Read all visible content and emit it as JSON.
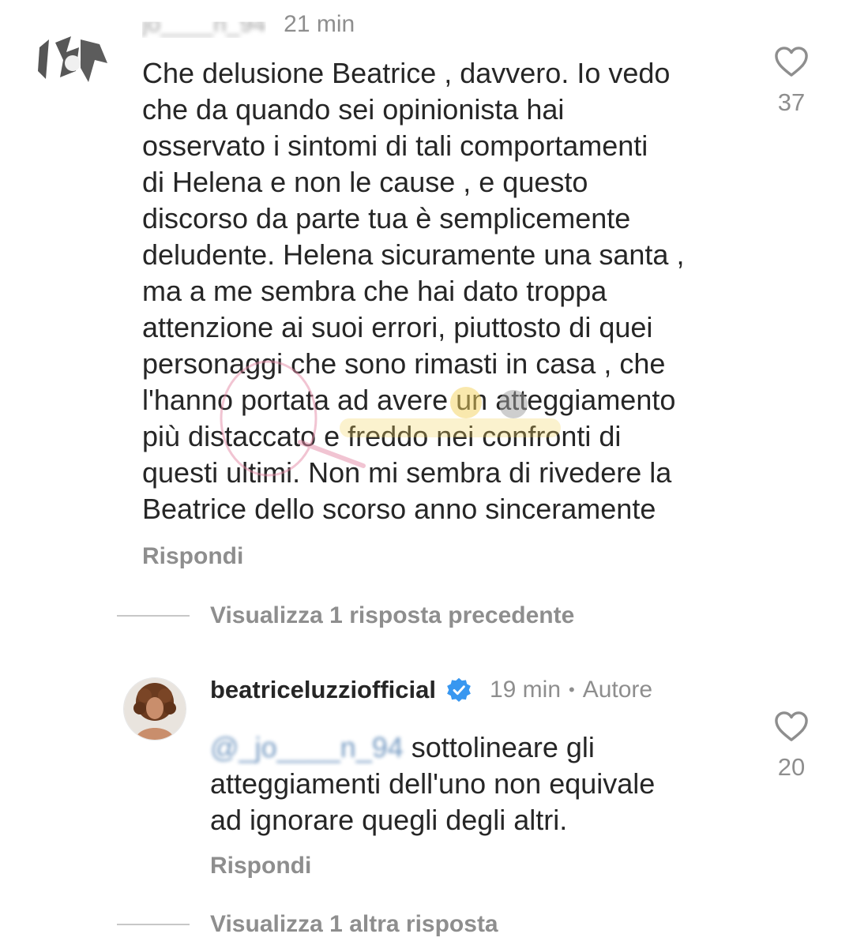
{
  "comment": {
    "username": "jo____n_94",
    "time": "21 min",
    "lines": [
      "Che delusione Beatrice , davvero. Io vedo",
      "che da quando sei opinionista hai",
      "osservato i sintomi di tali comportamenti",
      "di Helena e non le cause , e questo",
      "discorso da parte tua è semplicemente",
      "deludente. Helena sicuramente una santa ,",
      "ma a me sembra che hai dato troppa",
      "attenzione ai suoi errori, piuttosto di quei",
      "personaggi che sono rimasti in casa , che",
      "l'hanno portata ad avere un atteggiamento",
      "più distaccato e freddo nei confronti di",
      "questi ultimi. Non mi sembra di rivedere la",
      "Beatrice dello scorso anno sinceramente"
    ],
    "reply_label": "Rispondi",
    "likes": "37",
    "view_previous": "Visualizza 1 risposta precedente"
  },
  "reply": {
    "username": "beatriceluzziofficial",
    "time": "19 min",
    "separator": "•",
    "author_label": "Autore",
    "mention": "@_jo____n_94",
    "line1_rest": " sottolineare gli",
    "line2": "atteggiamenti dell'uno non equivale",
    "line3": "ad ignorare quegli degli altri.",
    "reply_label": "Rispondi",
    "likes": "20",
    "view_more": "Visualizza 1 altra risposta"
  },
  "icons": {
    "like": "heart-outline-icon",
    "verified": "verified-badge-icon"
  },
  "colors": {
    "text": "#262626",
    "secondary": "#8e8e8e",
    "verified": "#3897f0"
  }
}
